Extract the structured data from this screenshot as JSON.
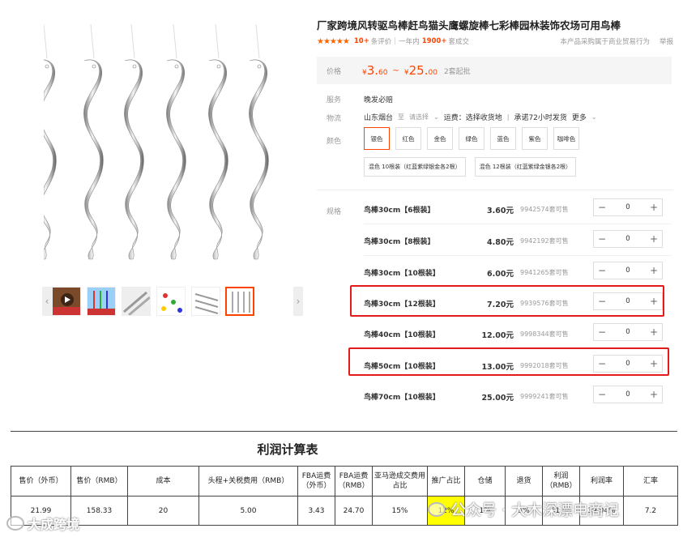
{
  "product": {
    "title": "厂家跨境风转驱鸟棒赶鸟猫头鹰螺旋棒七彩棒园林装饰农场可用鸟棒",
    "stars": "★★★★★",
    "review_count": "10+",
    "review_label": "条评价",
    "sold_prefix": "一年内",
    "sold_count": "1900+",
    "sold_suffix": "套成交",
    "notice": "本产品采购属于商业贸易行为",
    "report": "举报"
  },
  "price": {
    "label": "价格",
    "currency": "¥",
    "low_int": "3.",
    "low_dec": "60",
    "tilde": "~",
    "high_int": "25.",
    "high_dec": "00",
    "unit": "2套起批"
  },
  "attrs": {
    "service_label": "服务",
    "service_value": "晚发必赔",
    "logistics_label": "物流",
    "origin": "山东烟台",
    "to": "至",
    "dest": "请选择",
    "freight": "运费：选择收货地",
    "promise": "承诺72小时发货",
    "more": "更多",
    "color_label": "颜色"
  },
  "colors": [
    "银色",
    "红色",
    "金色",
    "绿色",
    "蓝色",
    "紫色",
    "咖啡色"
  ],
  "colors_mixed": [
    "混色 10根装（红蓝紫绿银金各2根）",
    "混色 12根装（红蓝紫绿金银各2根）"
  ],
  "spec_label": "规格",
  "specs": [
    {
      "name": "鸟棒30cm【6根装】",
      "price": "3.60元",
      "stock": "9942574套可售",
      "qty": "0"
    },
    {
      "name": "鸟棒30cm【8根装】",
      "price": "4.80元",
      "stock": "9942192套可售",
      "qty": "0"
    },
    {
      "name": "鸟棒30cm【10根装】",
      "price": "6.00元",
      "stock": "9941265套可售",
      "qty": "0"
    },
    {
      "name": "鸟棒30cm【12根装】",
      "price": "7.20元",
      "stock": "9939576套可售",
      "qty": "0"
    },
    {
      "name": "鸟棒40cm【10根装】",
      "price": "12.00元",
      "stock": "9998344套可售",
      "qty": "0"
    },
    {
      "name": "鸟棒50cm【10根装】",
      "price": "13.00元",
      "stock": "9992018套可售",
      "qty": "0"
    },
    {
      "name": "鸟棒70cm【10根装】",
      "price": "25.00元",
      "stock": "9999241套可售",
      "qty": "0"
    }
  ],
  "stepper": {
    "minus": "−",
    "plus": "+"
  },
  "highlight_color": "#e31b1b",
  "accent_color": "#ff4400",
  "profit_table": {
    "title": "利润计算表",
    "headers": [
      "售价（外币）",
      "售价（RMB）",
      "成本",
      "头程+关税费用（RMB）",
      "FBA运费（外币）",
      "FBA运费（RMB）",
      "亚马逊成交费用占比",
      "推广占比",
      "仓储",
      "退货",
      "利润（RMB）",
      "利润率",
      "汇率"
    ],
    "row": [
      "21.99",
      "158.33",
      "20",
      "5.00",
      "3.43",
      "24.70",
      "15%",
      "12%",
      "1%",
      "5%",
      "61.98",
      "39.04%",
      "7.2"
    ]
  },
  "watermarks": {
    "left": "大成跨境",
    "right": "公众号 · 大木深漂电商记"
  }
}
